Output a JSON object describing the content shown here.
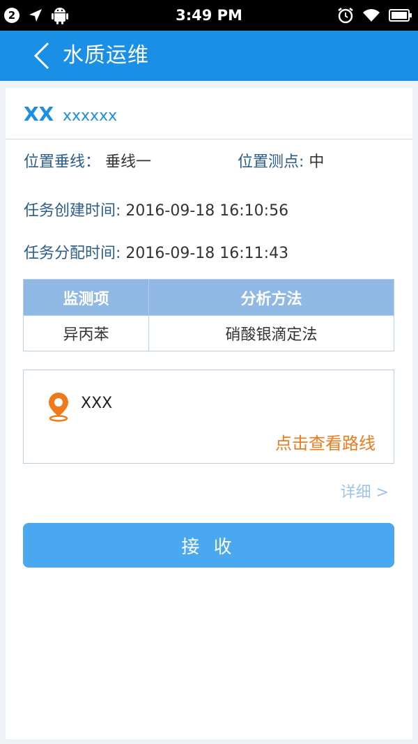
{
  "status_bar": {
    "notification_count": "2",
    "time": "3:49 PM"
  },
  "header": {
    "title": "水质运维"
  },
  "task": {
    "code": "XX",
    "name": "xxxxxx",
    "vertical_label": "位置垂线：",
    "vertical_value": "垂线一",
    "point_label": "位置测点:",
    "point_value": "中",
    "created_label": "任务创建时间:",
    "created_value": "2016-09-18 16:10:56",
    "assigned_label": "任务分配时间:",
    "assigned_value": "2016-09-18 16:11:43"
  },
  "table": {
    "headers": [
      "监测项",
      "分析方法"
    ],
    "rows": [
      [
        "异丙苯",
        "硝酸银滴定法"
      ]
    ]
  },
  "location": {
    "name": "XXX",
    "route_link": "点击查看路线"
  },
  "detail_link": "详细  >",
  "accept_button": "接 收",
  "colors": {
    "primary": "#1a8fe6",
    "button": "#4aa8f0",
    "accent_orange": "#f07a1a",
    "table_header": "#8fb9e4"
  }
}
